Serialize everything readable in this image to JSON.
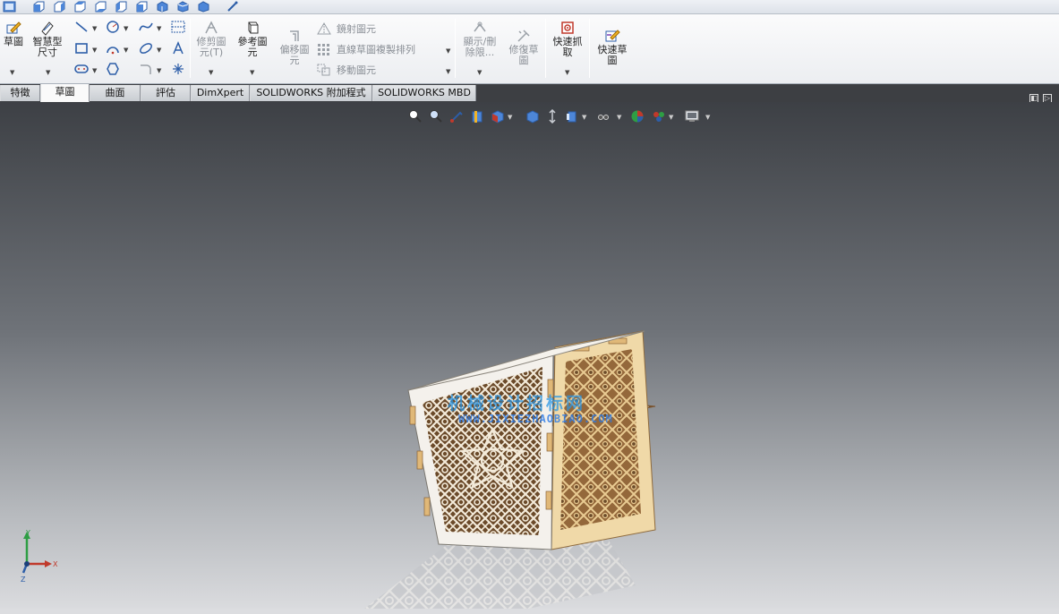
{
  "quick_strip": {
    "icons": [
      "front-view-icon",
      "back-view-icon",
      "left-view-icon",
      "right-view-icon",
      "top-view-icon",
      "bottom-view-icon",
      "isometric-view-icon",
      "trimetric-view-icon",
      "dimetric-view-icon",
      "normal-to-icon"
    ]
  },
  "ribbon": {
    "sketch": {
      "label": "草圖"
    },
    "smart_dim": {
      "label": "智慧型\n尺寸"
    },
    "trim": {
      "label": "修剪圖\n元(T)"
    },
    "convert": {
      "label": "參考圖\n元"
    },
    "offset": {
      "label": "偏移圖\n元"
    },
    "mirror": {
      "label": "鏡射圖元"
    },
    "linear_pattern": {
      "label": "直線草圖複製排列"
    },
    "move": {
      "label": "移動圖元"
    },
    "display_delete": {
      "label": "顯示/刪\n除限..."
    },
    "repair": {
      "label": "修復草\n圖"
    },
    "quick_snap": {
      "label": "快速抓\n取"
    },
    "rapid_sketch": {
      "label": "快速草\n圖"
    }
  },
  "tabs": [
    {
      "label": "特徵",
      "active": false
    },
    {
      "label": "草圖",
      "active": true
    },
    {
      "label": "曲面",
      "active": false
    },
    {
      "label": "評估",
      "active": false
    },
    {
      "label": "DimXpert",
      "active": false
    },
    {
      "label": "SOLIDWORKS 附加程式",
      "active": false
    },
    {
      "label": "SOLIDWORKS MBD",
      "active": false
    }
  ],
  "viewport": {
    "watermark_cn": "机械设计招标网",
    "watermark_url": "WWW.JIXIEZHAOBIAO.COM",
    "triad": {
      "x": "X",
      "y": "Y",
      "z": "Z"
    }
  },
  "colors": {
    "ribbon_bg": "#f4f5f7",
    "tab_bar": "#3d3f43",
    "accent": "#c0392b",
    "wood": "#e9c99a"
  }
}
